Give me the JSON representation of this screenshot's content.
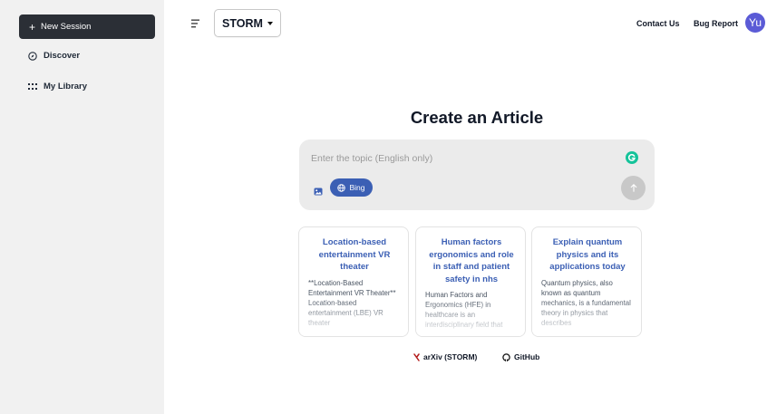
{
  "sidebar": {
    "new_session_label": "New Session",
    "items": [
      {
        "label": "Discover",
        "icon": "compass-icon"
      },
      {
        "label": "My Library",
        "icon": "grid-icon"
      }
    ]
  },
  "header": {
    "product_menu_label": "STORM",
    "contact_label": "Contact Us",
    "bug_report_label": "Bug Report",
    "avatar_initials": "Yu"
  },
  "main": {
    "title": "Create an Article",
    "topic_placeholder": "Enter the topic (English only)",
    "search_engine_label": "Bing"
  },
  "cards": [
    {
      "title": "Location-based entertainment VR theater",
      "snippet": "**Location-Based Entertainment VR Theater** Location-based entertainment (LBE) VR theater"
    },
    {
      "title": "Human factors ergonomics and role in staff and patient safety in nhs",
      "snippet": "Human Factors and Ergonomics (HFE) in healthcare is an interdisciplinary field that"
    },
    {
      "title": "Explain quantum physics and its applications today",
      "snippet": "Quantum physics, also known as quantum mechanics, is a fundamental theory in physics that describes"
    }
  ],
  "footer": {
    "arxiv_label": "arXiv (STORM)",
    "github_label": "GitHub"
  },
  "colors": {
    "accent": "#3b5fb4",
    "sidebar_bg": "#f1f1f1",
    "dark_button": "#2b2f36",
    "avatar_bg": "#5b5bd6",
    "arxiv_red": "#b31b1b",
    "grammarly_green": "#15c39a"
  }
}
